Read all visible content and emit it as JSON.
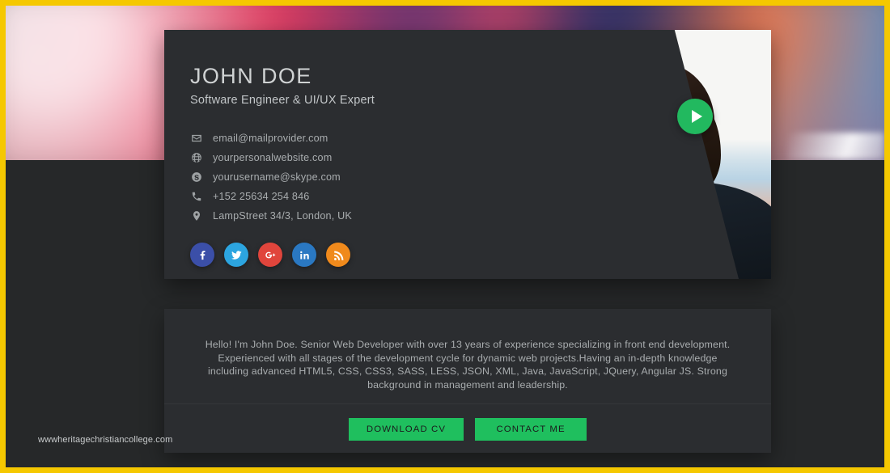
{
  "theme": {
    "frame_color": "#f5c800",
    "page_bg": "#262829",
    "card_bg": "#2b2d30",
    "accent_green": "#1fbf5e",
    "play_green": "#22b95f",
    "text_muted": "#a9adaf",
    "heading": "#cfd2d3"
  },
  "profile": {
    "name": "JOHN DOE",
    "role": "Software Engineer & UI/UX Expert",
    "contacts": [
      {
        "icon": "envelope-icon",
        "label": "email@mailprovider.com"
      },
      {
        "icon": "globe-icon",
        "label": "yourpersonalwebsite.com"
      },
      {
        "icon": "skype-icon",
        "label": "yourusername@skype.com"
      },
      {
        "icon": "phone-icon",
        "label": "+152 25634 254 846"
      },
      {
        "icon": "location-pin-icon",
        "label": "LampStreet 34/3, London, UK"
      }
    ],
    "socials": [
      {
        "name": "facebook",
        "glyph": "f",
        "color": "#3b4fa8"
      },
      {
        "name": "twitter",
        "glyph": "t",
        "color": "#2ca5e0"
      },
      {
        "name": "google-plus",
        "glyph": "G+",
        "color": "#e0453c"
      },
      {
        "name": "linkedin",
        "glyph": "in",
        "color": "#2a78c2"
      },
      {
        "name": "rss",
        "glyph": "rss",
        "color": "#f08a1c"
      }
    ],
    "play_label": "play-video"
  },
  "bio": {
    "text": "Hello! I'm John Doe. Senior Web Developer with over 13 years of experience specializing in front end development. Experienced with all stages of the development cycle for dynamic web projects.Having an in-depth knowledge including advanced HTML5, CSS, CSS3, SASS, LESS, JSON, XML, Java, JavaScript, JQuery, Angular JS. Strong background in management and leadership."
  },
  "actions": {
    "download_cv": "DOWNLOAD CV",
    "contact_me": "CONTACT ME"
  },
  "watermark": {
    "text": "wwwheritagechristiancollege.com"
  }
}
